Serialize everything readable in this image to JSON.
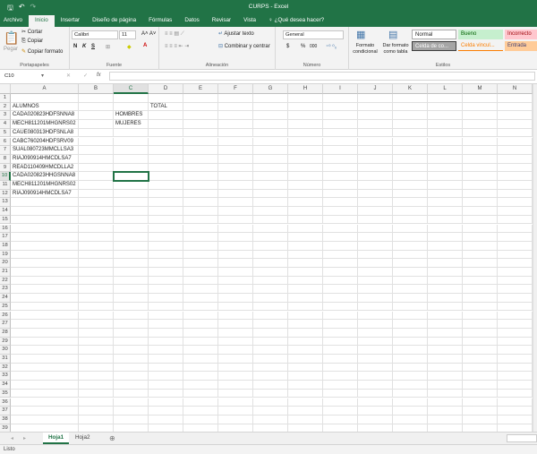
{
  "window": {
    "title": "CURPS - Excel"
  },
  "tabs": [
    "Archivo",
    "Inicio",
    "Insertar",
    "Diseño de página",
    "Fórmulas",
    "Datos",
    "Revisar",
    "Vista"
  ],
  "tell_me": "¿Qué desea hacer?",
  "ribbon": {
    "clipboard": {
      "paste": "Pegar",
      "cut": "Cortar",
      "copy": "Copiar",
      "format_painter": "Copiar formato",
      "label": "Portapapeles"
    },
    "font": {
      "name": "Calibri",
      "size": "11",
      "bold": "N",
      "italic": "K",
      "underline": "S",
      "label": "Fuente"
    },
    "alignment": {
      "wrap": "Ajustar texto",
      "merge": "Combinar y centrar",
      "label": "Alineación"
    },
    "number": {
      "format": "General",
      "currency": "$",
      "percent": "%",
      "thousands": "000",
      "label": "Número"
    },
    "styles": {
      "conditional": "Formato condicional",
      "as_table": "Dar formato como tabla",
      "normal": "Normal",
      "good": "Bueno",
      "bad": "Incorrecto",
      "check": "Celda de co...",
      "linked": "Celda vincul...",
      "input": "Entrada",
      "label": "Estilos"
    }
  },
  "formula_bar": {
    "name_box": "C10",
    "content": ""
  },
  "columns": [
    "A",
    "B",
    "C",
    "D",
    "E",
    "F",
    "G",
    "H",
    "I",
    "J",
    "K",
    "L",
    "M",
    "N"
  ],
  "row_count": 39,
  "cells": [
    {
      "ref": "A2",
      "col": 0,
      "row": 2,
      "v": "ALUMNOS"
    },
    {
      "ref": "D2",
      "col": 3,
      "row": 2,
      "v": "TOTAL"
    },
    {
      "ref": "A3",
      "col": 0,
      "row": 3,
      "v": "CADA020823HDFSNNA8"
    },
    {
      "ref": "C3",
      "col": 2,
      "row": 3,
      "v": "HOMBRES"
    },
    {
      "ref": "A4",
      "col": 0,
      "row": 4,
      "v": "MECH811201MHGNRS02"
    },
    {
      "ref": "C4",
      "col": 2,
      "row": 4,
      "v": "MUJERES"
    },
    {
      "ref": "A5",
      "col": 0,
      "row": 5,
      "v": "CAUE080313HDFSNLA8"
    },
    {
      "ref": "A6",
      "col": 0,
      "row": 6,
      "v": "CABC760204HDFSRV09"
    },
    {
      "ref": "A7",
      "col": 0,
      "row": 7,
      "v": "SUAL080723MMCLLSA3"
    },
    {
      "ref": "A8",
      "col": 0,
      "row": 8,
      "v": "RIAJ090914HMCDLSA7"
    },
    {
      "ref": "A9",
      "col": 0,
      "row": 9,
      "v": "READ110409HMCDLLA2"
    },
    {
      "ref": "A10",
      "col": 0,
      "row": 10,
      "v": "CADA020823HHGSNNA8"
    },
    {
      "ref": "A11",
      "col": 0,
      "row": 11,
      "v": "MECH811201MHGNRS02"
    },
    {
      "ref": "A12",
      "col": 0,
      "row": 12,
      "v": "RIAJ090914HMCDLSA7"
    }
  ],
  "selected": {
    "col": 2,
    "row": 10
  },
  "sheets": [
    "Hoja1",
    "Hoja2"
  ],
  "active_sheet": "Hoja1",
  "status": "Listo",
  "colors": {
    "brand": "#217346"
  }
}
